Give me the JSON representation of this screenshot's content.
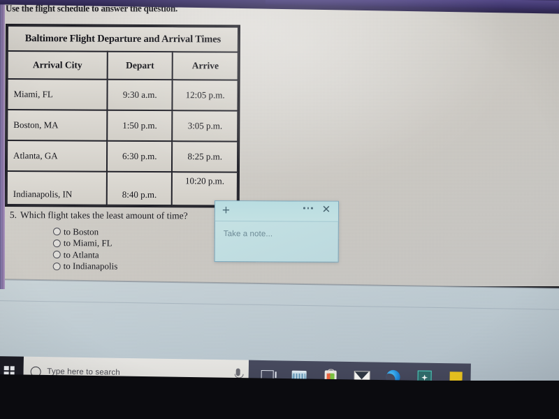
{
  "document": {
    "instruction": "Use the flight schedule to answer the question."
  },
  "table": {
    "title": "Baltimore Flight Departure and Arrival Times",
    "columns": [
      "Arrival City",
      "Depart",
      "Arrive"
    ],
    "rows": [
      {
        "city": "Miami, FL",
        "depart": "9:30 a.m.",
        "arrive": "12:05 p.m."
      },
      {
        "city": "Boston, MA",
        "depart": "1:50 p.m.",
        "arrive": "3:05 p.m."
      },
      {
        "city": "Atlanta, GA",
        "depart": "6:30 p.m.",
        "arrive": "8:25 p.m."
      },
      {
        "city": "Indianapolis, IN",
        "depart": "8:40 p.m.",
        "arrive": "10:20 p.m."
      }
    ]
  },
  "question": {
    "number": "5.",
    "text": "Which flight takes the least amount of time?",
    "options": [
      {
        "label": "to Boston",
        "selected": false
      },
      {
        "label": "to Miami, FL",
        "selected": false
      },
      {
        "label": "to Atlanta",
        "selected": false
      },
      {
        "label": "to Indianapolis",
        "selected": false
      }
    ]
  },
  "sticky_note": {
    "add_label": "+",
    "menu_label": "",
    "close_label": "✕",
    "placeholder": "Take a note...",
    "body_value": "",
    "background_color": "#c2dfe2",
    "border_color": "#7ba8bd"
  },
  "taskbar": {
    "start_label": "Start",
    "search_placeholder": "Type here to search",
    "search_value": "",
    "buttons": [
      {
        "name": "task-view",
        "label": "Task View"
      },
      {
        "name": "file-explorer",
        "label": "File Explorer"
      },
      {
        "name": "microsoft-store",
        "label": "Microsoft Store"
      },
      {
        "name": "mail",
        "label": "Mail"
      },
      {
        "name": "microsoft-edge",
        "label": "Microsoft Edge"
      },
      {
        "name": "teal-app",
        "label": "App"
      },
      {
        "name": "sticky-notes",
        "label": "Sticky Notes"
      }
    ]
  },
  "colors": {
    "page_background": "#d6d3cd",
    "desktop_background": "#bfccd3",
    "taskbar_background": "#424557",
    "note_accent": "#7ba8bd",
    "top_band": "#443a72"
  }
}
